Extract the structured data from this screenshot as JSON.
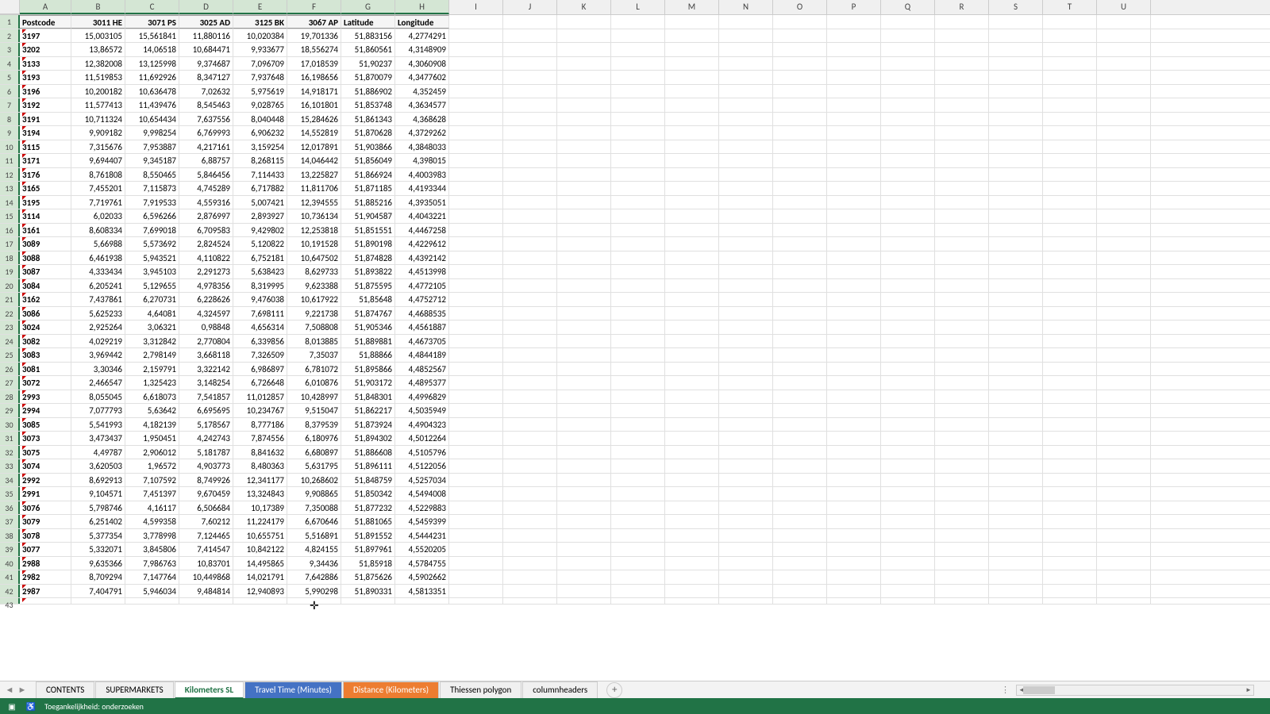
{
  "columns": [
    "A",
    "B",
    "C",
    "D",
    "E",
    "F",
    "G",
    "H",
    "I",
    "J",
    "K",
    "L",
    "M",
    "N",
    "O",
    "P",
    "Q",
    "R",
    "S",
    "T",
    "U"
  ],
  "headers": [
    "Postcode",
    "3011 HE",
    "3071 PS",
    "3025 AD",
    "3125 BK",
    "3067 AP",
    "Latitude",
    "Longitude"
  ],
  "rows": [
    [
      "3197",
      "15,003105",
      "15,561841",
      "11,880116",
      "10,020384",
      "19,701336",
      "51,883156",
      "4,2774291"
    ],
    [
      "3202",
      "13,86572",
      "14,06518",
      "10,684471",
      "9,933677",
      "18,556274",
      "51,860561",
      "4,3148909"
    ],
    [
      "3133",
      "12,382008",
      "13,125998",
      "9,374687",
      "7,096709",
      "17,018539",
      "51,90237",
      "4,3060908"
    ],
    [
      "3193",
      "11,519853",
      "11,692926",
      "8,347127",
      "7,937648",
      "16,198656",
      "51,870079",
      "4,3477602"
    ],
    [
      "3196",
      "10,200182",
      "10,636478",
      "7,02632",
      "5,975619",
      "14,918171",
      "51,886902",
      "4,352459"
    ],
    [
      "3192",
      "11,577413",
      "11,439476",
      "8,545463",
      "9,028765",
      "16,101801",
      "51,853748",
      "4,3634577"
    ],
    [
      "3191",
      "10,711324",
      "10,654434",
      "7,637556",
      "8,040448",
      "15,284626",
      "51,861343",
      "4,368628"
    ],
    [
      "3194",
      "9,909182",
      "9,998254",
      "6,769993",
      "6,906232",
      "14,552819",
      "51,870628",
      "4,3729262"
    ],
    [
      "3115",
      "7,315676",
      "7,953887",
      "4,217161",
      "3,159254",
      "12,017891",
      "51,903866",
      "4,3848033"
    ],
    [
      "3171",
      "9,694407",
      "9,345187",
      "6,88757",
      "8,268115",
      "14,046442",
      "51,856049",
      "4,398015"
    ],
    [
      "3176",
      "8,761808",
      "8,550465",
      "5,846456",
      "7,114433",
      "13,225827",
      "51,866924",
      "4,4003983"
    ],
    [
      "3165",
      "7,455201",
      "7,115873",
      "4,745289",
      "6,717882",
      "11,811706",
      "51,871185",
      "4,4193344"
    ],
    [
      "3195",
      "7,719761",
      "7,919533",
      "4,559316",
      "5,007421",
      "12,394555",
      "51,885216",
      "4,3935051"
    ],
    [
      "3114",
      "6,02033",
      "6,596266",
      "2,876997",
      "2,893927",
      "10,736134",
      "51,904587",
      "4,4043221"
    ],
    [
      "3161",
      "8,608334",
      "7,699018",
      "6,709583",
      "9,429802",
      "12,253818",
      "51,851551",
      "4,4467258"
    ],
    [
      "3089",
      "5,66988",
      "5,573692",
      "2,824524",
      "5,120822",
      "10,191528",
      "51,890198",
      "4,4229612"
    ],
    [
      "3088",
      "6,461938",
      "5,943521",
      "4,110822",
      "6,752181",
      "10,647502",
      "51,874828",
      "4,4392142"
    ],
    [
      "3087",
      "4,333434",
      "3,945103",
      "2,291273",
      "5,638423",
      "8,629733",
      "51,893822",
      "4,4513998"
    ],
    [
      "3084",
      "6,205241",
      "5,129655",
      "4,978356",
      "8,319995",
      "9,623388",
      "51,875595",
      "4,4772105"
    ],
    [
      "3162",
      "7,437861",
      "6,270731",
      "6,228626",
      "9,476038",
      "10,617922",
      "51,85648",
      "4,4752712"
    ],
    [
      "3086",
      "5,625233",
      "4,64081",
      "4,324597",
      "7,698111",
      "9,221738",
      "51,874767",
      "4,4688535"
    ],
    [
      "3024",
      "2,925264",
      "3,06321",
      "0,98848",
      "4,656314",
      "7,508808",
      "51,905346",
      "4,4561887"
    ],
    [
      "3082",
      "4,029219",
      "3,312842",
      "2,770804",
      "6,339856",
      "8,013885",
      "51,889881",
      "4,4673705"
    ],
    [
      "3083",
      "3,969442",
      "2,798149",
      "3,668118",
      "7,326509",
      "7,35037",
      "51,88866",
      "4,4844189"
    ],
    [
      "3081",
      "3,30346",
      "2,159791",
      "3,322142",
      "6,986897",
      "6,781072",
      "51,895866",
      "4,4852567"
    ],
    [
      "3072",
      "2,466547",
      "1,325423",
      "3,148254",
      "6,726648",
      "6,010876",
      "51,903172",
      "4,4895377"
    ],
    [
      "2993",
      "8,055045",
      "6,618073",
      "7,541857",
      "11,012857",
      "10,428997",
      "51,848301",
      "4,4996829"
    ],
    [
      "2994",
      "7,077793",
      "5,63642",
      "6,695695",
      "10,234767",
      "9,515047",
      "51,862217",
      "4,5035949"
    ],
    [
      "3085",
      "5,541993",
      "4,182139",
      "5,178567",
      "8,777186",
      "8,379539",
      "51,873924",
      "4,4904323"
    ],
    [
      "3073",
      "3,473437",
      "1,950451",
      "4,242743",
      "7,874556",
      "6,180976",
      "51,894302",
      "4,5012264"
    ],
    [
      "3075",
      "4,49787",
      "2,906012",
      "5,181787",
      "8,841632",
      "6,680897",
      "51,886608",
      "4,5105796"
    ],
    [
      "3074",
      "3,620503",
      "1,96572",
      "4,903773",
      "8,480363",
      "5,631795",
      "51,896111",
      "4,5122056"
    ],
    [
      "2992",
      "8,692913",
      "7,107592",
      "8,749926",
      "12,341177",
      "10,268602",
      "51,848759",
      "4,5257034"
    ],
    [
      "2991",
      "9,104571",
      "7,451397",
      "9,670459",
      "13,324843",
      "9,908865",
      "51,850342",
      "4,5494008"
    ],
    [
      "3076",
      "5,798746",
      "4,16117",
      "6,506684",
      "10,17389",
      "7,350088",
      "51,877232",
      "4,5229883"
    ],
    [
      "3079",
      "6,251402",
      "4,599358",
      "7,60212",
      "11,224179",
      "6,670646",
      "51,881065",
      "4,5459399"
    ],
    [
      "3078",
      "5,377354",
      "3,778998",
      "7,124465",
      "10,655751",
      "5,516891",
      "51,891552",
      "4,5444231"
    ],
    [
      "3077",
      "5,332071",
      "3,845806",
      "7,414547",
      "10,842122",
      "4,824155",
      "51,897961",
      "4,5520205"
    ],
    [
      "2988",
      "9,635366",
      "7,986763",
      "10,83701",
      "14,495865",
      "9,34436",
      "51,85918",
      "4,5784755"
    ],
    [
      "2982",
      "8,709294",
      "7,147764",
      "10,449868",
      "14,021791",
      "7,642886",
      "51,875626",
      "4,5902662"
    ],
    [
      "2987",
      "7,404791",
      "5,946034",
      "9,484814",
      "12,940893",
      "5,990298",
      "51,890331",
      "4,5813351"
    ]
  ],
  "tabs": [
    {
      "label": "CONTENTS",
      "style": "plain"
    },
    {
      "label": "SUPERMARKETS",
      "style": "plain"
    },
    {
      "label": "Kilometers SL",
      "style": "active-green"
    },
    {
      "label": "Travel Time (Minutes)",
      "style": "blue"
    },
    {
      "label": "Distance (Kilometers)",
      "style": "orange"
    },
    {
      "label": "Thiessen polygon",
      "style": "plain"
    },
    {
      "label": "columnheaders",
      "style": "plain"
    }
  ],
  "status": {
    "accessibility_label": "Toegankelijkheid: onderzoeken"
  }
}
